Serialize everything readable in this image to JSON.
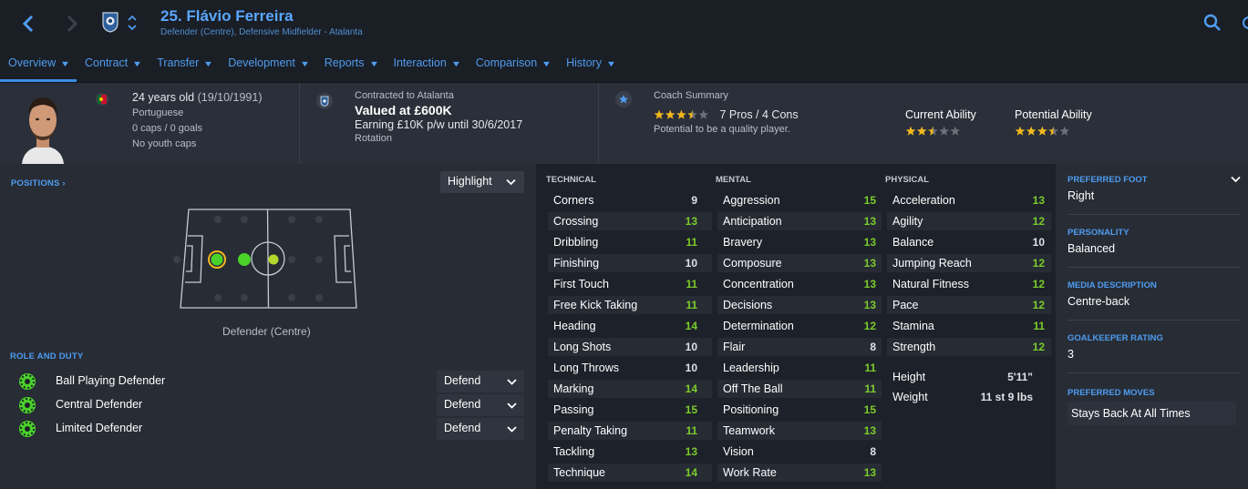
{
  "header": {
    "title": "25. Flávio Ferreira",
    "subtitle": "Defender (Centre), Defensive Midfielder - Atalanta",
    "tabs": [
      {
        "label": "Overview"
      },
      {
        "label": "Contract"
      },
      {
        "label": "Transfer"
      },
      {
        "label": "Development"
      },
      {
        "label": "Reports"
      },
      {
        "label": "Interaction"
      },
      {
        "label": "Comparison"
      },
      {
        "label": "History"
      }
    ]
  },
  "info": {
    "age": "24 years old",
    "dob": "(19/10/1991)",
    "nationality": "Portuguese",
    "caps": "0 caps / 0 goals",
    "youth_caps": "No youth caps",
    "contract_label": "Contracted to Atalanta",
    "value": "Valued at £600K",
    "earning": "Earning £10K p/w until 30/6/2017",
    "status": "Rotation",
    "coach_label": "Coach Summary",
    "pros_cons": "7 Pros / 4 Cons",
    "coach_note": "Potential to be a quality player.",
    "coach_stars": 3.5,
    "current_ability_label": "Current Ability",
    "current_ability_stars": 2.5,
    "potential_ability_label": "Potential Ability",
    "potential_ability_stars": 3.5
  },
  "positions": {
    "heading": "POSITIONS",
    "view_select": "Highlight",
    "position_label": "Defender (Centre)"
  },
  "roles": {
    "heading": "ROLE AND DUTY",
    "items": [
      {
        "name": "Ball Playing Defender",
        "duty": "Defend"
      },
      {
        "name": "Central Defender",
        "duty": "Defend"
      },
      {
        "name": "Limited Defender",
        "duty": "Defend"
      }
    ]
  },
  "attributes": {
    "technical_heading": "TECHNICAL",
    "mental_heading": "MENTAL",
    "physical_heading": "PHYSICAL",
    "technical": [
      {
        "name": "Corners",
        "value": "9"
      },
      {
        "name": "Crossing",
        "value": "13"
      },
      {
        "name": "Dribbling",
        "value": "11"
      },
      {
        "name": "Finishing",
        "value": "10"
      },
      {
        "name": "First Touch",
        "value": "11"
      },
      {
        "name": "Free Kick Taking",
        "value": "11"
      },
      {
        "name": "Heading",
        "value": "14"
      },
      {
        "name": "Long Shots",
        "value": "10"
      },
      {
        "name": "Long Throws",
        "value": "10"
      },
      {
        "name": "Marking",
        "value": "14"
      },
      {
        "name": "Passing",
        "value": "15"
      },
      {
        "name": "Penalty Taking",
        "value": "11"
      },
      {
        "name": "Tackling",
        "value": "13"
      },
      {
        "name": "Technique",
        "value": "14"
      }
    ],
    "mental": [
      {
        "name": "Aggression",
        "value": "15"
      },
      {
        "name": "Anticipation",
        "value": "13"
      },
      {
        "name": "Bravery",
        "value": "13"
      },
      {
        "name": "Composure",
        "value": "13"
      },
      {
        "name": "Concentration",
        "value": "13"
      },
      {
        "name": "Decisions",
        "value": "13"
      },
      {
        "name": "Determination",
        "value": "12"
      },
      {
        "name": "Flair",
        "value": "8"
      },
      {
        "name": "Leadership",
        "value": "11"
      },
      {
        "name": "Off The Ball",
        "value": "11"
      },
      {
        "name": "Positioning",
        "value": "15"
      },
      {
        "name": "Teamwork",
        "value": "13"
      },
      {
        "name": "Vision",
        "value": "8"
      },
      {
        "name": "Work Rate",
        "value": "13"
      }
    ],
    "physical": [
      {
        "name": "Acceleration",
        "value": "13"
      },
      {
        "name": "Agility",
        "value": "12"
      },
      {
        "name": "Balance",
        "value": "10"
      },
      {
        "name": "Jumping Reach",
        "value": "12"
      },
      {
        "name": "Natural Fitness",
        "value": "12"
      },
      {
        "name": "Pace",
        "value": "12"
      },
      {
        "name": "Stamina",
        "value": "11"
      },
      {
        "name": "Strength",
        "value": "12"
      }
    ],
    "height_label": "Height",
    "height": "5'11\"",
    "weight_label": "Weight",
    "weight": "11 st 9 lbs"
  },
  "profile": {
    "foot_heading": "PREFERRED FOOT",
    "foot": "Right",
    "personality_heading": "PERSONALITY",
    "personality": "Balanced",
    "media_heading": "MEDIA DESCRIPTION",
    "media": "Centre-back",
    "gk_heading": "GOALKEEPER RATING",
    "gk": "3",
    "moves_heading": "PREFERRED MOVES",
    "moves": [
      "Stays Back At All Times"
    ]
  },
  "colors": {
    "accent": "#4f9cf0",
    "attr_high": "#7ccc2c",
    "attr_low": "#dfe2e6",
    "star": "#f0b81f"
  }
}
